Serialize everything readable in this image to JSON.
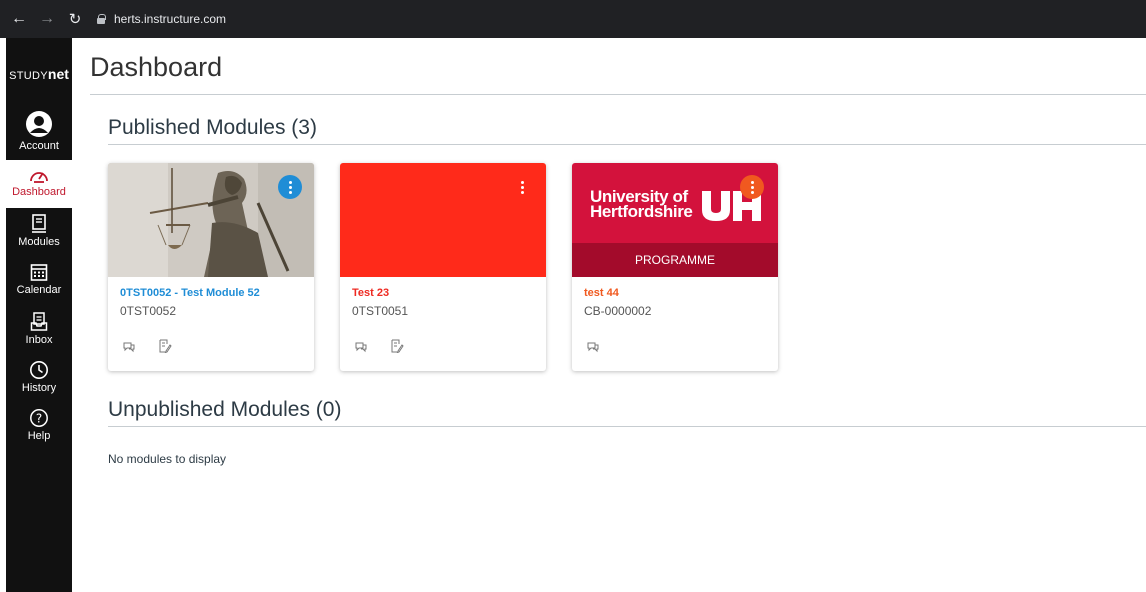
{
  "browser": {
    "url": "herts.instructure.com"
  },
  "nav": {
    "logo_prefix": "STUDY",
    "logo_suffix": "net",
    "items": [
      {
        "label": "Account",
        "icon": "account-icon"
      },
      {
        "label": "Dashboard",
        "icon": "dashboard-icon"
      },
      {
        "label": "Modules",
        "icon": "modules-icon"
      },
      {
        "label": "Calendar",
        "icon": "calendar-icon"
      },
      {
        "label": "Inbox",
        "icon": "inbox-icon"
      },
      {
        "label": "History",
        "icon": "history-icon"
      },
      {
        "label": "Help",
        "icon": "help-icon"
      }
    ],
    "active_color": "#c0182d"
  },
  "page": {
    "title": "Dashboard",
    "published_heading": "Published Modules (3)",
    "unpublished_heading": "Unpublished Modules (0)",
    "empty_text": "No modules to display"
  },
  "cards": [
    {
      "title": "0TST0052 - Test Module 52",
      "code": "0TST0052",
      "title_color": "#1f8dd6",
      "kebab_color": "#1f8dd6",
      "hero": "justice-statue-image",
      "icons": [
        "announcements-icon",
        "assignments-icon"
      ]
    },
    {
      "title": "Test 23",
      "code": "0TST0051",
      "title_color": "#ee2a22",
      "hero_color": "#ff2a1a",
      "icons": [
        "announcements-icon",
        "assignments-icon"
      ]
    },
    {
      "title": "test 44",
      "code": "CB-0000002",
      "title_color": "#f0591f",
      "kebab_color": "#f0591f",
      "hero_color": "#d3123c",
      "hero_logo_line1": "University of",
      "hero_logo_line2": "Hertfordshire",
      "hero_mark": "UH",
      "hero_band": "PROGRAMME",
      "icons": [
        "announcements-icon"
      ]
    }
  ]
}
